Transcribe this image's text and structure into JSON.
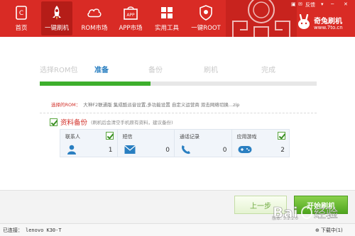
{
  "nav": {
    "items": [
      {
        "label": "首页",
        "icon": "phone-icon"
      },
      {
        "label": "一键刷机",
        "icon": "rocket-icon"
      },
      {
        "label": "ROM市场",
        "icon": "cloud-icon"
      },
      {
        "label": "APP市场",
        "icon": "app-bag-icon"
      },
      {
        "label": "实用工具",
        "icon": "grid-icon"
      },
      {
        "label": "一键ROOT",
        "icon": "shield-icon"
      }
    ],
    "active_index": 1
  },
  "window": {
    "feedback": "反馈",
    "brand_name": "奇兔刷机",
    "brand_url": "www.7to.cn"
  },
  "steps": {
    "items": [
      "选择ROM包",
      "准备",
      "备份",
      "刷机",
      "完成"
    ],
    "current_index": 1,
    "progress": 0.4
  },
  "rom": {
    "label": "选择的ROM：",
    "value": "大神F2联通版 集成酷派音设置,多功能设置 自定义运营商 双击网络切换...zip"
  },
  "backup": {
    "title": "资料备份",
    "note": "(刷机后会清空手机原有资料，建议备份)",
    "items": [
      {
        "title": "联系人",
        "count": "1",
        "icon": "contact-icon",
        "checked": true
      },
      {
        "title": "短信",
        "count": "0",
        "icon": "envelope-icon",
        "checked": false
      },
      {
        "title": "通话记录",
        "count": "0",
        "icon": "phone-handset-icon",
        "checked": false
      },
      {
        "title": "应用游戏",
        "count": "2",
        "icon": "gamepad-icon",
        "checked": true
      }
    ]
  },
  "buttons": {
    "prev": "上一步",
    "start": "开始刷机"
  },
  "status": {
    "connected_label": "已连接：",
    "device": "lenovo K30-T",
    "version": "版本: 5.2.2.0",
    "downloads": "下载中(1)"
  },
  "colors": {
    "topbar": "#d92b25",
    "accent_blue": "#2a7fc1",
    "progress_green": "#3daf2c",
    "warn_red": "#d12c25"
  }
}
